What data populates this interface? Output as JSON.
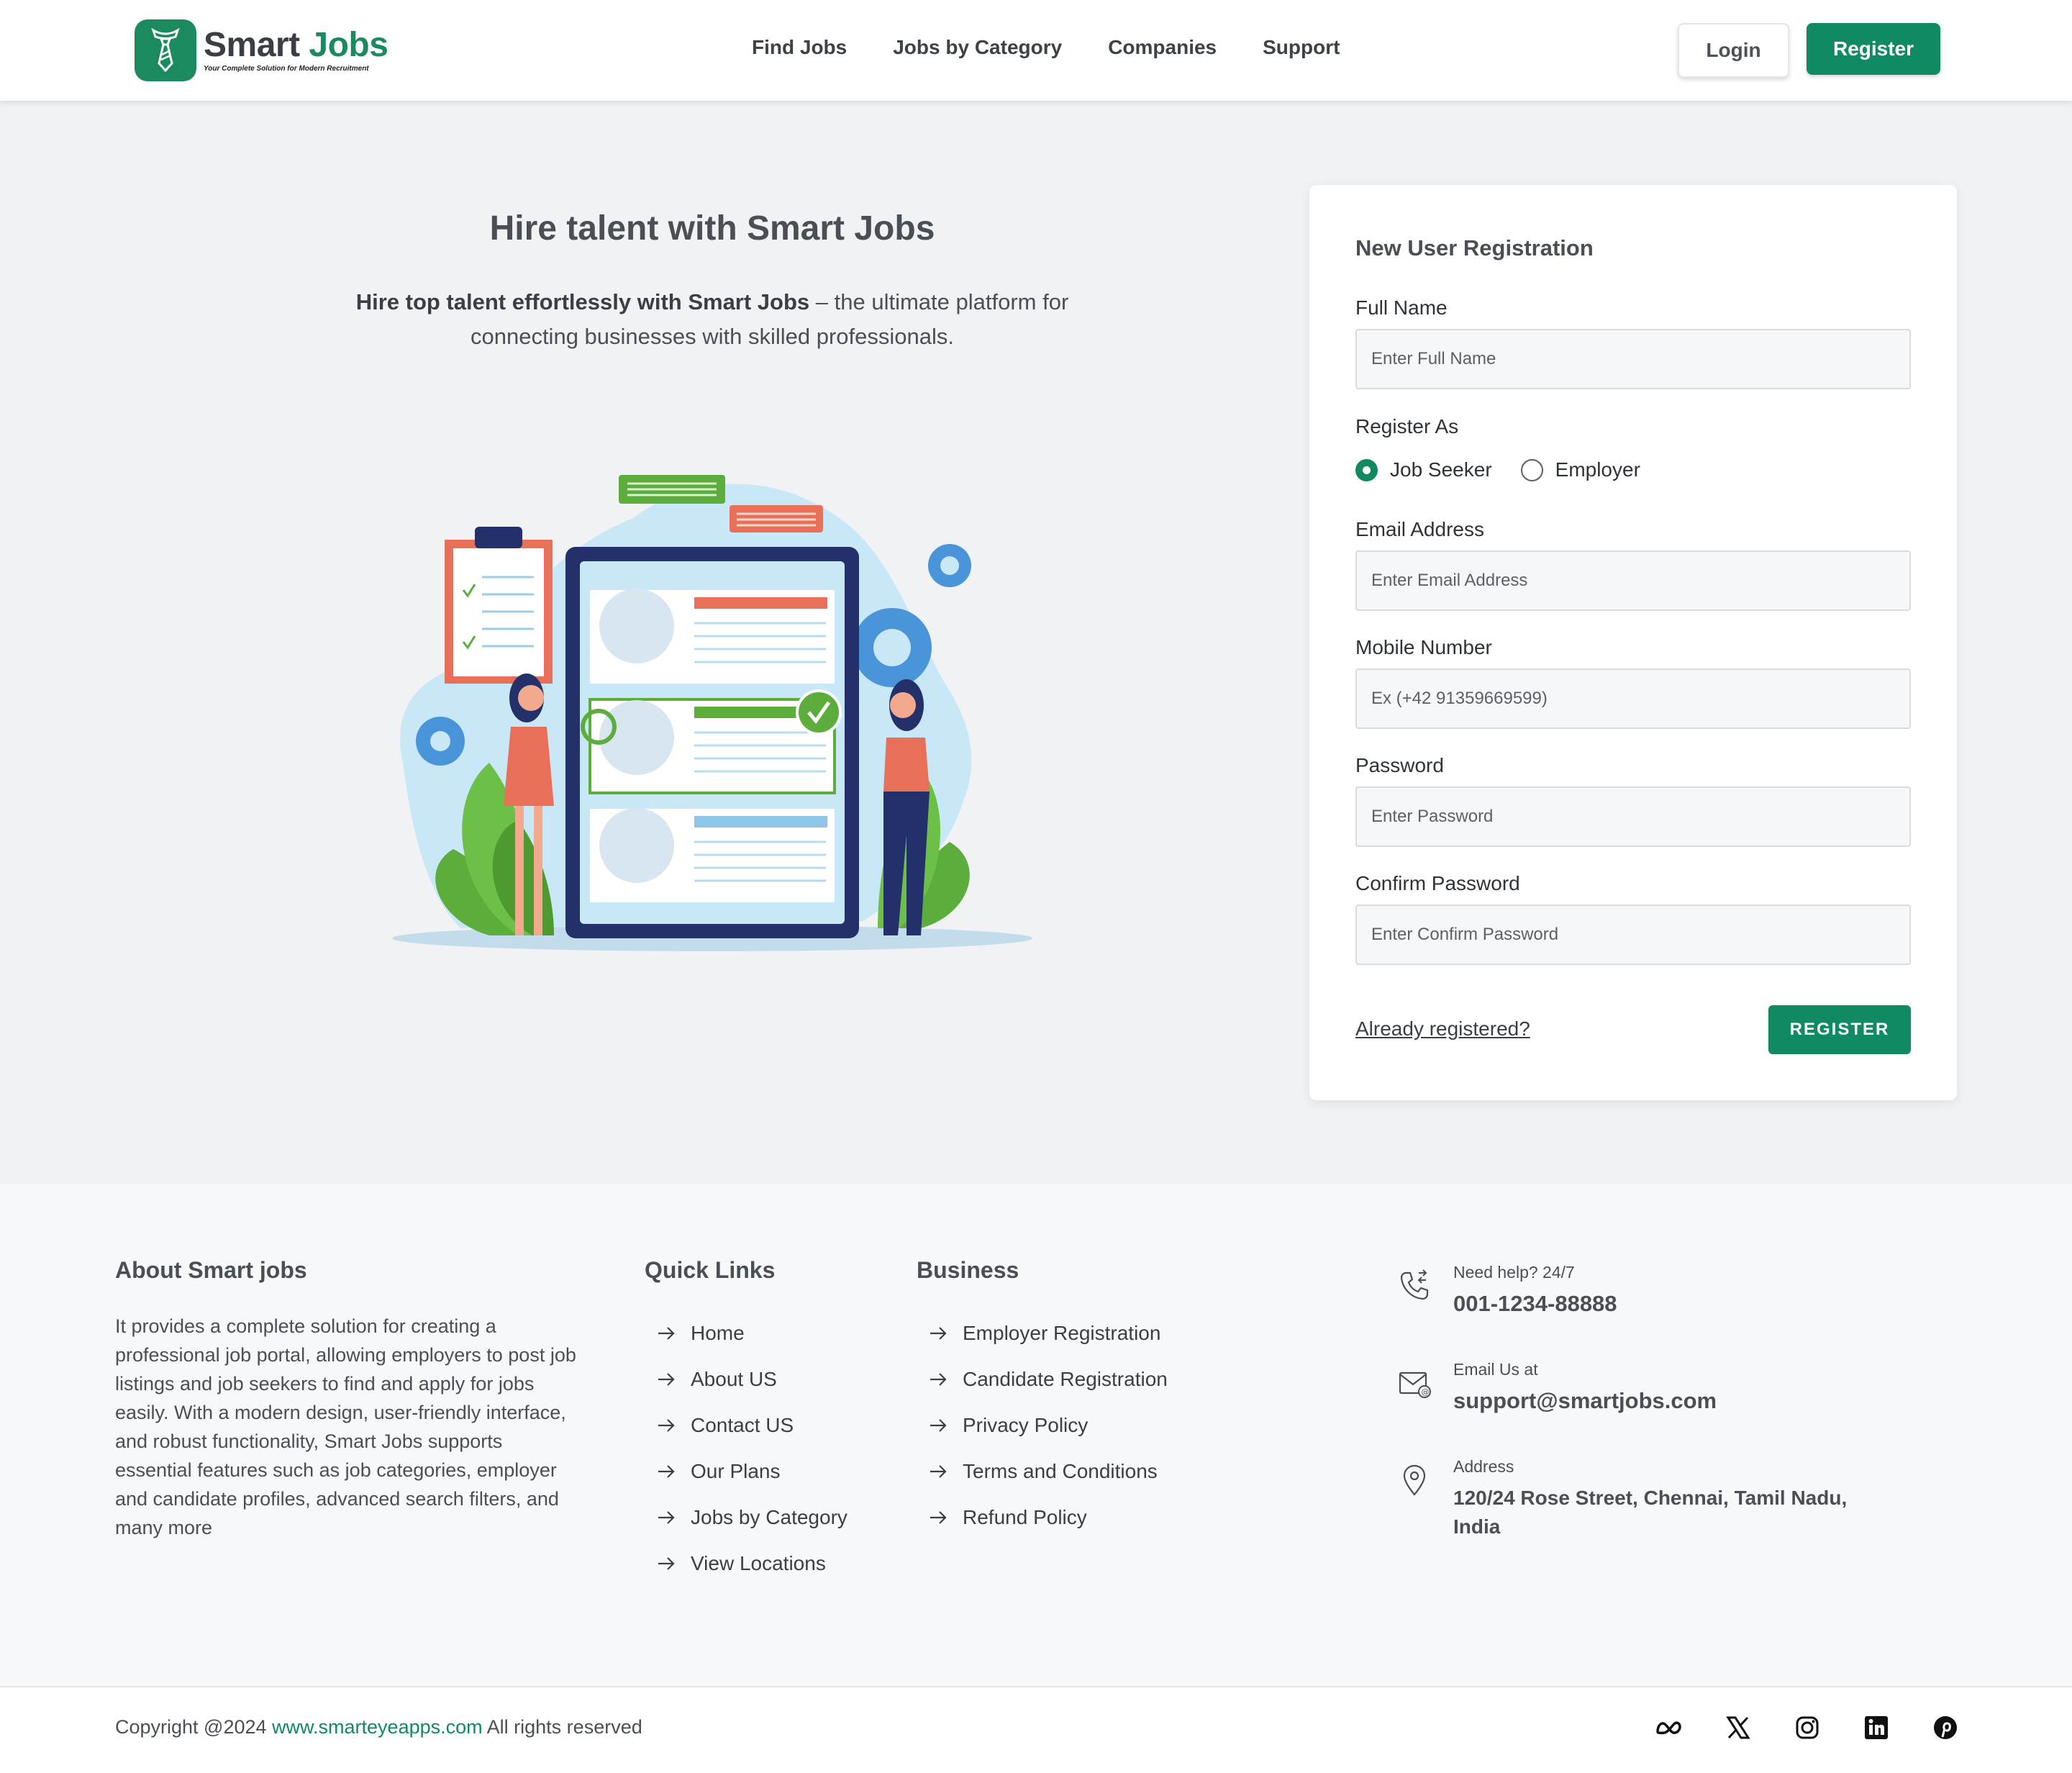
{
  "brand": {
    "name_part1": "Smart",
    "name_part2": "Jobs",
    "tagline": "Your Complete Solution for Modern Recruitment",
    "primary_color": "#0f8a62"
  },
  "nav": {
    "items": [
      "Find Jobs",
      "Jobs by Category",
      "Companies",
      "Support"
    ],
    "login": "Login",
    "register": "Register"
  },
  "hero": {
    "title": "Hire talent with Smart Jobs",
    "lead_bold": "Hire top talent effortlessly with Smart Jobs",
    "lead_rest": " – the ultimate platform for connecting businesses with skilled professionals."
  },
  "form": {
    "title": "New User Registration",
    "full_name": {
      "label": "Full Name",
      "placeholder": "Enter Full Name",
      "value": ""
    },
    "register_as": {
      "label": "Register As",
      "options": [
        "Job Seeker",
        "Employer"
      ],
      "selected": "Job Seeker"
    },
    "email": {
      "label": "Email Address",
      "placeholder": "Enter Email Address",
      "value": ""
    },
    "mobile": {
      "label": "Mobile Number",
      "placeholder": "Ex (+42 91359669599)",
      "value": ""
    },
    "password": {
      "label": "Password",
      "placeholder": "Enter Password",
      "value": ""
    },
    "confirm_password": {
      "label": "Confirm Password",
      "placeholder": "Enter Confirm Password",
      "value": ""
    },
    "already_link": "Already registered?",
    "submit": "REGISTER"
  },
  "footer": {
    "about": {
      "heading": "About Smart jobs",
      "text": "It provides a complete solution for creating a professional job portal, allowing employers to post job listings and job seekers to find and apply for jobs easily. With a modern design, user-friendly interface, and robust functionality, Smart Jobs supports essential features such as job categories, employer and candidate profiles, advanced search filters, and many more"
    },
    "quick_links": {
      "heading": "Quick Links",
      "items": [
        "Home",
        "About US",
        "Contact US",
        "Our Plans",
        "Jobs by Category",
        "View Locations"
      ]
    },
    "business": {
      "heading": "Business",
      "items": [
        "Employer Registration",
        "Candidate Registration",
        "Privacy Policy",
        "Terms and Conditions",
        "Refund Policy"
      ]
    },
    "contact": {
      "phone_label": "Need help? 24/7",
      "phone": "001-1234-88888",
      "email_label": "Email Us at",
      "email": "support@smartjobs.com",
      "address_label": "Address",
      "address": "120/24 Rose Street, Chennai, Tamil Nadu, India"
    },
    "copyright": {
      "prefix": "Copyright @2024 ",
      "site": "www.smarteyeapps.com",
      "suffix": " All rights reserved"
    },
    "socials": [
      "meta-icon",
      "x-icon",
      "instagram-icon",
      "linkedin-icon",
      "pinterest-icon"
    ]
  }
}
